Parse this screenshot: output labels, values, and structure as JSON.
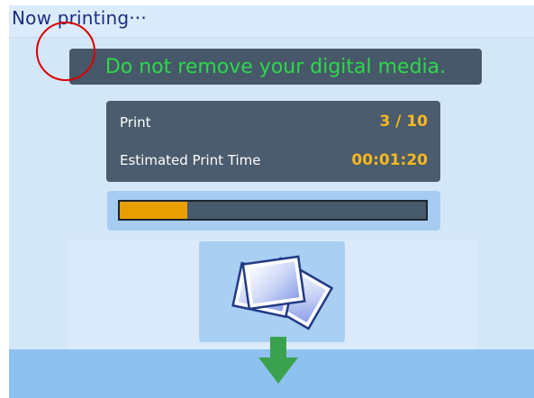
{
  "title": "Now printing···",
  "warning": "Do not remove your digital media.",
  "info": {
    "print_label": "Print",
    "print_value": "3 / 10",
    "time_label": "Estimated Print Time",
    "time_value": "00:01:20"
  },
  "progress": {
    "fraction": 0.22
  },
  "icons": [
    "photos-stack-icon",
    "arrow-down-icon"
  ],
  "colors": {
    "background": "#d4e7f9",
    "title_text": "#1b2f80",
    "warning_text": "#2cd94a",
    "info_value": "#f7b81f",
    "progress_fill": "#ea9f00",
    "panel": "#4a5c6d",
    "arrow": "#3aa24e",
    "annotation": "#d80000"
  }
}
